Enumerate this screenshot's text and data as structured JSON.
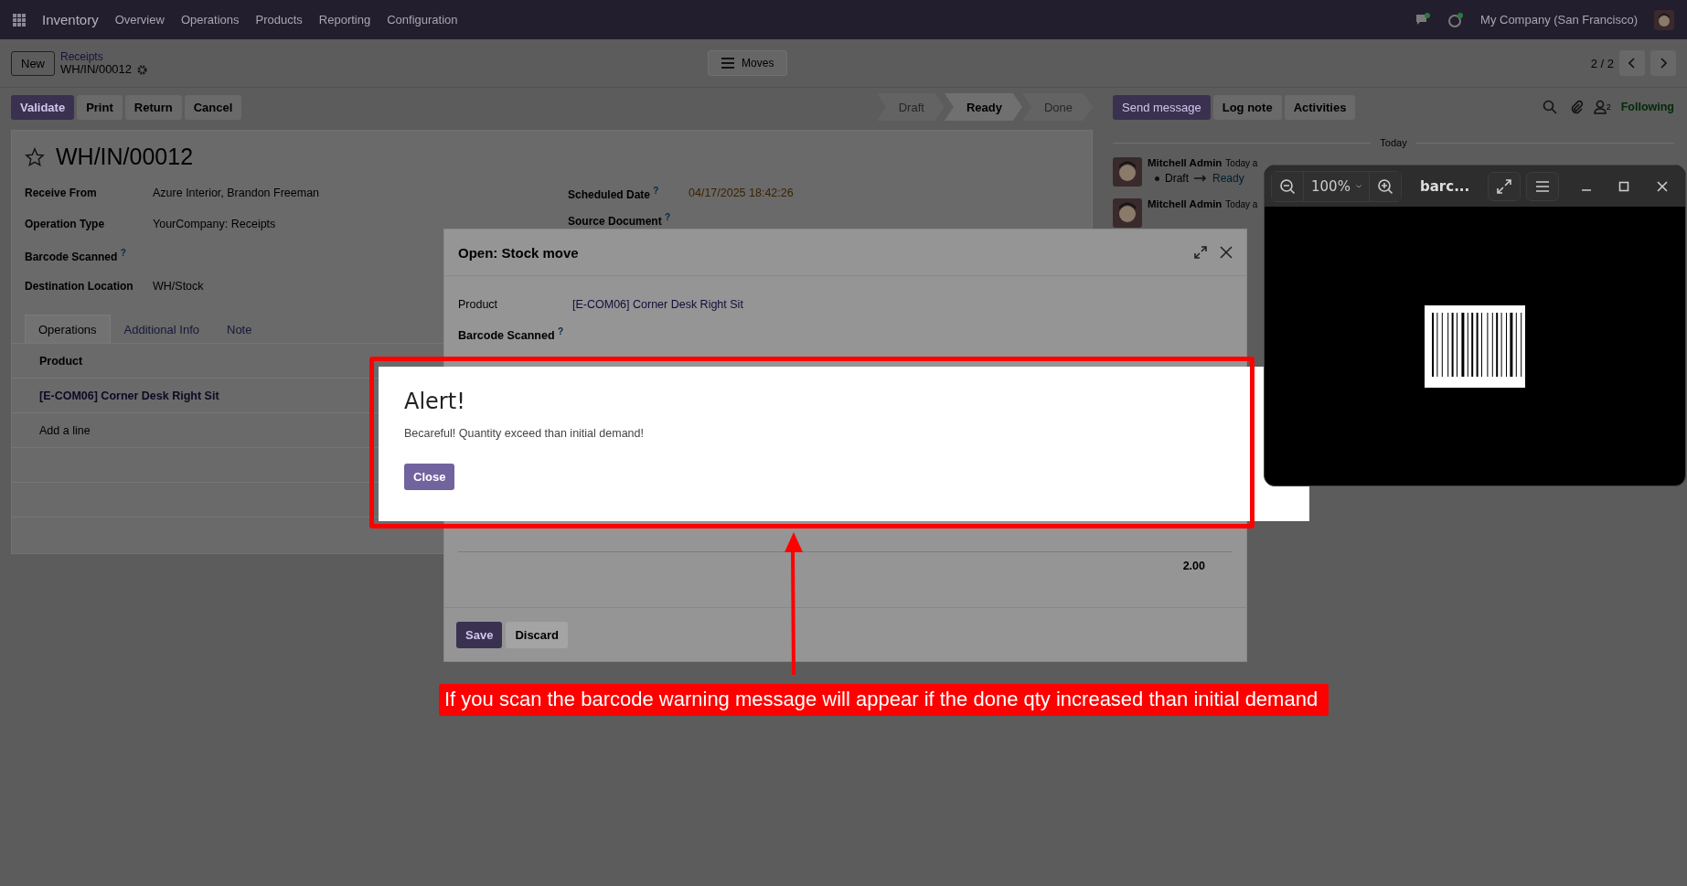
{
  "navbar": {
    "app_name": "Inventory",
    "menu": [
      "Overview",
      "Operations",
      "Products",
      "Reporting",
      "Configuration"
    ],
    "company": "My Company (San Francisco)"
  },
  "control_panel": {
    "new_button": "New",
    "breadcrumb_parent": "Receipts",
    "breadcrumb_current": "WH/IN/00012",
    "view_button": "Moves",
    "pager": "2 / 2"
  },
  "actions": [
    {
      "label": "Validate",
      "kind": "primary"
    },
    {
      "label": "Print",
      "kind": "secondary"
    },
    {
      "label": "Return",
      "kind": "secondary"
    },
    {
      "label": "Cancel",
      "kind": "secondary"
    }
  ],
  "status_steps": [
    {
      "label": "Draft",
      "selected": false
    },
    {
      "label": "Ready",
      "selected": true
    },
    {
      "label": "Done",
      "selected": false
    }
  ],
  "form": {
    "title": "WH/IN/00012",
    "left_fields": [
      {
        "label": "Receive From",
        "value": "Azure Interior, Brandon Freeman"
      },
      {
        "label": "Operation Type",
        "value": "YourCompany: Receipts"
      },
      {
        "label": "Barcode Scanned $^{?}$"
      },
      {
        "label": "Destination Location",
        "value": "WH/Stock"
      }
    ],
    "right_fields": [
      {
        "label": "Scheduled Date $^{?}$",
        "value": "04/17/2025 18:42:26"
      },
      {
        "label": "Source Document $^{?}$"
      }
    ],
    "tabs": [
      {
        "label": "Operations",
        "selected": true
      },
      {
        "label": "Additional Info",
        "selected": false
      },
      {
        "label": "Note",
        "selected": false
      }
    ],
    "table": {
      "columns": [
        "Product"
      ],
      "rows": [
        "[E-COM06] Corner Desk Right Sit"
      ],
      "add_line": "Add a line"
    }
  },
  "chatter": {
    "buttons": [
      {
        "label": "Send message",
        "kind": "primary"
      },
      {
        "label": "Log note",
        "kind": "secondary"
      },
      {
        "label": "Activities",
        "kind": "secondary"
      }
    ],
    "followers": "2",
    "follow_state": "Following",
    "date_divider": "Today",
    "messages": [
      {
        "author": "Mitchell Admin",
        "time": "Today a",
        "from": "Draft",
        "to": "Ready"
      },
      {
        "author": "Mitchell Admin",
        "time": "Today a"
      }
    ]
  },
  "dialog": {
    "title": "Open: Stock move",
    "fields": [
      {
        "label": "Product",
        "value": "[E-COM06] Corner Desk Right Sit"
      },
      {
        "label": "Barcode Scanned $^{?}$"
      }
    ],
    "total": "2.00",
    "buttons": [
      {
        "label": "Save",
        "kind": "primary"
      },
      {
        "label": "Discard",
        "kind": "secondary"
      }
    ]
  },
  "alert": {
    "title": "Alert!",
    "message": "Becareful! Quantity exceed than initial demand!",
    "button": "Close"
  },
  "viewer": {
    "zoom": "100%",
    "title": "barc..."
  },
  "annotation": {
    "text": "If you scan the barcode warning message will appear if the done qty increased than initial demand"
  }
}
